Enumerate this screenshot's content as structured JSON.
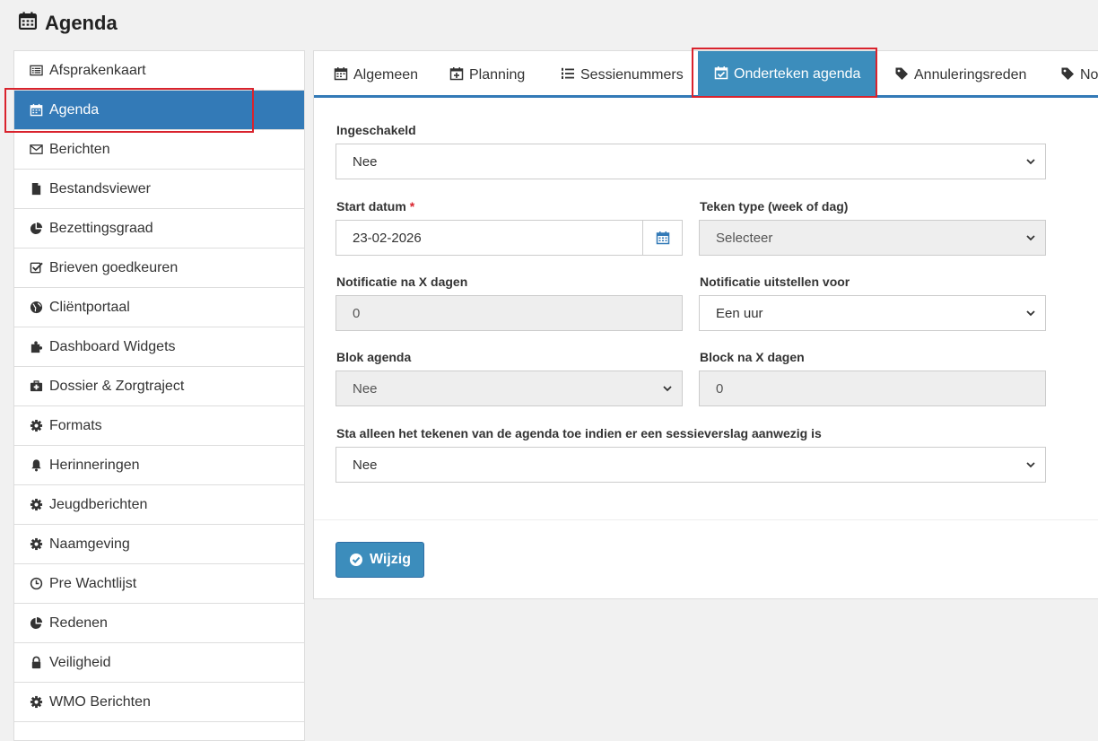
{
  "page": {
    "title": "Agenda",
    "icon": "calendar-icon"
  },
  "sidebar": {
    "items": [
      {
        "label": "Afsprakenkaart",
        "icon": "list-alt-icon"
      },
      {
        "label": "Agenda",
        "icon": "calendar-icon",
        "active": true
      },
      {
        "label": "Berichten",
        "icon": "envelope-icon"
      },
      {
        "label": "Bestandsviewer",
        "icon": "file-icon"
      },
      {
        "label": "Bezettingsgraad",
        "icon": "pie-chart-icon"
      },
      {
        "label": "Brieven goedkeuren",
        "icon": "check-square-icon"
      },
      {
        "label": "Cliëntportaal",
        "icon": "globe-icon"
      },
      {
        "label": "Dashboard Widgets",
        "icon": "puzzle-icon"
      },
      {
        "label": "Dossier & Zorgtraject",
        "icon": "medkit-icon"
      },
      {
        "label": "Formats",
        "icon": "gear-icon"
      },
      {
        "label": "Herinneringen",
        "icon": "bell-icon"
      },
      {
        "label": "Jeugdberichten",
        "icon": "gear-icon"
      },
      {
        "label": "Naamgeving",
        "icon": "gear-icon"
      },
      {
        "label": "Pre Wachtlijst",
        "icon": "clock-icon"
      },
      {
        "label": "Redenen",
        "icon": "pie-chart-icon"
      },
      {
        "label": "Veiligheid",
        "icon": "lock-icon"
      },
      {
        "label": "WMO Berichten",
        "icon": "gear-icon"
      }
    ]
  },
  "tabs": [
    {
      "label": "Algemeen",
      "icon": "calendar-icon"
    },
    {
      "label": "Planning",
      "icon": "calendar-plus-icon"
    },
    {
      "label": "Sessienummers",
      "icon": "list-ol-icon"
    },
    {
      "label": "Onderteken agenda",
      "icon": "calendar-check-icon",
      "active": true
    },
    {
      "label": "Annuleringsreden",
      "icon": "tag-icon"
    },
    {
      "label": "No",
      "icon": "tag-icon"
    }
  ],
  "form": {
    "ingeschakeld": {
      "label": "Ingeschakeld",
      "value": "Nee"
    },
    "start_datum": {
      "label": "Start datum",
      "required_mark": "*",
      "value": "23-02-2026"
    },
    "teken_type": {
      "label": "Teken type (week of dag)",
      "value": "Selecteer"
    },
    "notificatie_dagen": {
      "label": "Notificatie na X dagen",
      "value": "0"
    },
    "notificatie_uitstellen": {
      "label": "Notificatie uitstellen voor",
      "value": "Een uur"
    },
    "blok_agenda": {
      "label": "Blok agenda",
      "value": "Nee"
    },
    "block_dagen": {
      "label": "Block na X dagen",
      "value": "0"
    },
    "sessieverslag": {
      "label": "Sta alleen het tekenen van de agenda toe indien er een sessieverslag aanwezig is",
      "value": "Nee"
    }
  },
  "actions": {
    "save_label": "Wijzig"
  },
  "colors": {
    "primary": "#3c8dbc",
    "active_sidebar": "#337ab7",
    "highlight": "#d9232d"
  }
}
